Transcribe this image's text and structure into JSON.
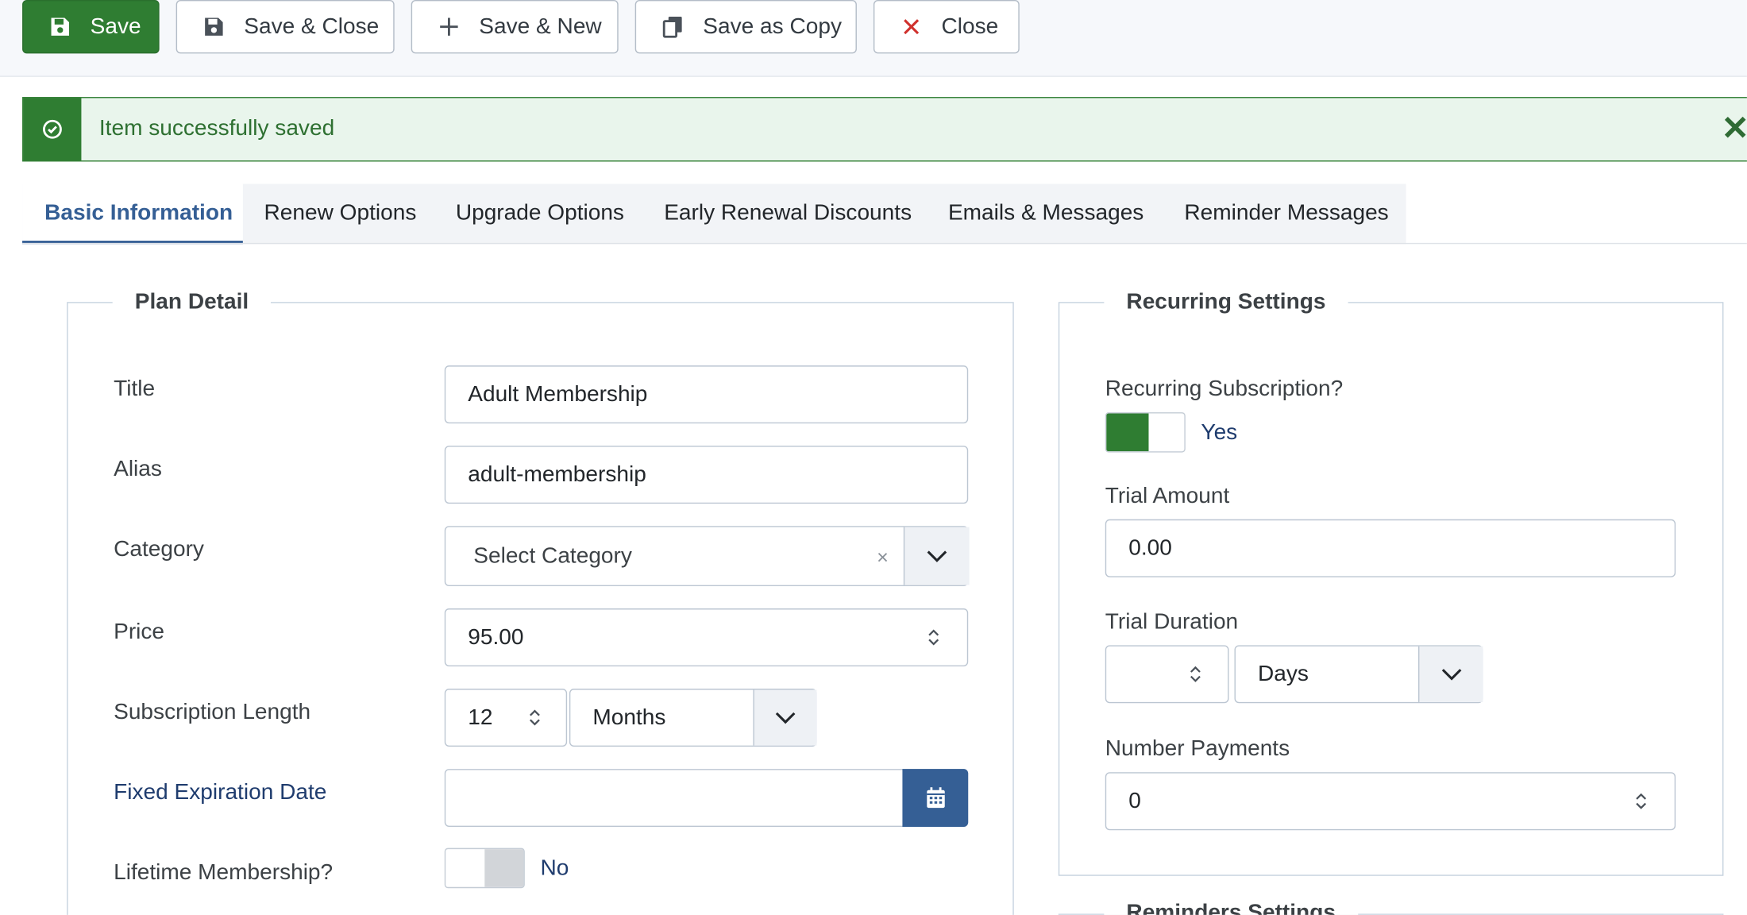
{
  "toolbar": {
    "save": "Save",
    "save_close": "Save & Close",
    "save_new": "Save & New",
    "save_copy": "Save as Copy",
    "close": "Close"
  },
  "alert": {
    "message": "Item successfully saved"
  },
  "tabs": [
    "Basic Information",
    "Renew Options",
    "Upgrade Options",
    "Early Renewal Discounts",
    "Emails & Messages",
    "Reminder Messages"
  ],
  "plan_detail": {
    "legend": "Plan Detail",
    "title_label": "Title",
    "title_value": "Adult Membership",
    "alias_label": "Alias",
    "alias_value": "adult-membership",
    "category_label": "Category",
    "category_placeholder": "Select Category",
    "category_clear": "×",
    "price_label": "Price",
    "price_value": "95.00",
    "length_label": "Subscription Length",
    "length_value": "12",
    "length_unit": "Months",
    "fixed_exp_label": "Fixed Expiration Date",
    "fixed_exp_value": "",
    "lifetime_label": "Lifetime Membership?",
    "lifetime_value": "No"
  },
  "recurring": {
    "legend": "Recurring Settings",
    "recurring_label": "Recurring Subscription?",
    "recurring_value": "Yes",
    "trial_amount_label": "Trial Amount",
    "trial_amount_value": "0.00",
    "trial_duration_label": "Trial Duration",
    "trial_duration_value": "",
    "trial_duration_unit": "Days",
    "num_payments_label": "Number Payments",
    "num_payments_value": "0"
  },
  "reminders": {
    "legend": "Reminders Settings"
  },
  "colors": {
    "primary": "#2f7d32",
    "accent": "#355f95",
    "alert_bg": "#e9f5ec",
    "close_x": "#d0312d"
  }
}
